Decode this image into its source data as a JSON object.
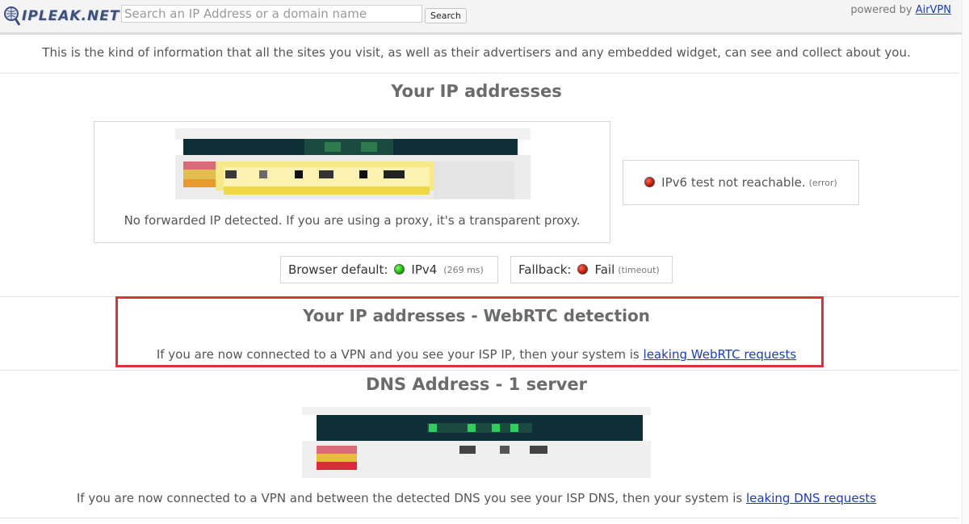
{
  "header": {
    "logo_text": "IPLEAK.NET",
    "search_placeholder": "Search an IP Address or a domain name",
    "search_button": "Search",
    "powered_prefix": "powered by",
    "powered_link": "AirVPN"
  },
  "intro": "This is the kind of information that all the sites you visit, as well as their advertisers and any embedded widget, can see and collect about you.",
  "ip_section": {
    "title": "Your IP addresses",
    "forwarded_note": "No forwarded IP detected. If you are using a proxy, it's a transparent proxy.",
    "ipv6_status": "IPv6 test not reachable.",
    "ipv6_note": "(error)",
    "browser_default_label": "Browser default:",
    "browser_default_value": "IPv4",
    "browser_default_time": "(269 ms)",
    "fallback_label": "Fallback:",
    "fallback_value": "Fail",
    "fallback_note": "(timeout)"
  },
  "webrtc_section": {
    "title": "Your IP addresses - WebRTC detection",
    "text": "If you are now connected to a VPN and you see your ISP IP, then your system is",
    "link": "leaking WebRTC requests"
  },
  "dns_section": {
    "title": "DNS Address - 1 server",
    "text": "If you are now connected to a VPN and between the detected DNS you see your ISP DNS, then your system is",
    "link": "leaking DNS requests"
  },
  "colors": {
    "highlight_border": "#d8353a",
    "link": "#1a3cc8",
    "status_red": "#c01400",
    "status_green": "#16b000"
  }
}
